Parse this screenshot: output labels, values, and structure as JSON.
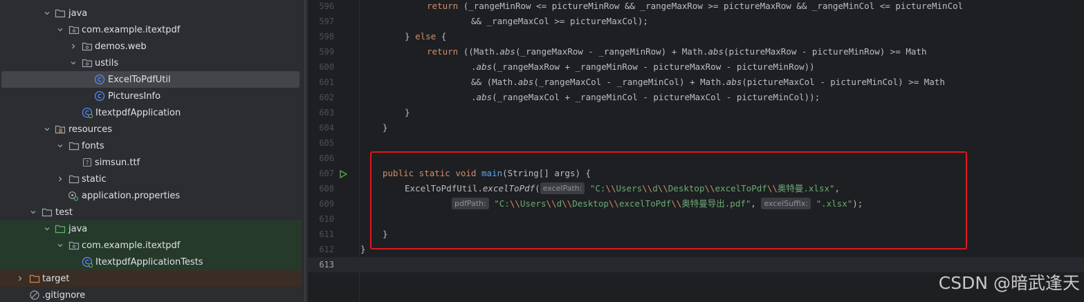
{
  "project_tree": {
    "items": [
      {
        "label": "java",
        "icon": "folder-icon"
      },
      {
        "label": "com.example.itextpdf",
        "icon": "package-icon"
      },
      {
        "label": "demos.web",
        "icon": "package-icon"
      },
      {
        "label": "ustils",
        "icon": "package-icon"
      },
      {
        "label": "ExcelToPdfUtil",
        "icon": "java-class-icon"
      },
      {
        "label": "PicturesInfo",
        "icon": "java-class-icon"
      },
      {
        "label": "ItextpdfApplication",
        "icon": "spring-boot-class-icon"
      },
      {
        "label": "resources",
        "icon": "resources-folder-icon"
      },
      {
        "label": "fonts",
        "icon": "folder-icon"
      },
      {
        "label": "simsun.ttf",
        "icon": "unknown-file-icon"
      },
      {
        "label": "static",
        "icon": "folder-icon"
      },
      {
        "label": "application.properties",
        "icon": "properties-file-icon"
      },
      {
        "label": "test",
        "icon": "folder-icon"
      },
      {
        "label": "java",
        "icon": "test-source-folder-icon"
      },
      {
        "label": "com.example.itextpdf",
        "icon": "package-icon"
      },
      {
        "label": "ItextpdfApplicationTests",
        "icon": "spring-boot-class-icon"
      },
      {
        "label": "target",
        "icon": "excluded-folder-icon"
      },
      {
        "label": ".gitignore",
        "icon": "ignore-file-icon"
      }
    ]
  },
  "editor": {
    "lines": [
      {
        "number": "596",
        "segments": [
          [
            "kw",
            "return "
          ],
          [
            "",
            "(_rangeMinRow <= pictureMinRow && _rangeMaxRow >= pictureMaxRow && _rangeMinCol <= pictureMinCol"
          ]
        ]
      },
      {
        "number": "597",
        "segments": [
          [
            "",
            "&& _rangeMaxCol >= pictureMaxCol);"
          ]
        ]
      },
      {
        "number": "598",
        "segments": [
          [
            "",
            "} "
          ],
          [
            "kw",
            "else "
          ],
          [
            "",
            "{"
          ]
        ]
      },
      {
        "number": "599",
        "segments": [
          [
            "kw",
            "return "
          ],
          [
            "",
            "((Math."
          ],
          [
            "it",
            "abs"
          ],
          [
            "",
            "(_rangeMaxRow - _rangeMinRow) + Math."
          ],
          [
            "it",
            "abs"
          ],
          [
            "",
            "(pictureMaxRow - pictureMinRow) >= Math"
          ]
        ]
      },
      {
        "number": "600",
        "segments": [
          [
            "",
            "."
          ],
          [
            "it",
            "abs"
          ],
          [
            "",
            "(_rangeMaxRow + _rangeMinRow - pictureMaxRow - pictureMinRow))"
          ]
        ]
      },
      {
        "number": "601",
        "segments": [
          [
            "",
            "&& (Math."
          ],
          [
            "it",
            "abs"
          ],
          [
            "",
            "(_rangeMaxCol - _rangeMinCol) + Math."
          ],
          [
            "it",
            "abs"
          ],
          [
            "",
            "(pictureMaxCol - pictureMinCol) >= Math"
          ]
        ]
      },
      {
        "number": "602",
        "segments": [
          [
            "",
            "."
          ],
          [
            "it",
            "abs"
          ],
          [
            "",
            "(_rangeMaxCol + _rangeMinCol - pictureMaxCol - pictureMinCol));"
          ]
        ]
      },
      {
        "number": "603",
        "segments": [
          [
            "",
            "}"
          ]
        ]
      },
      {
        "number": "604",
        "segments": [
          [
            "",
            "}"
          ]
        ]
      },
      {
        "number": "605",
        "segments": []
      },
      {
        "number": "606",
        "segments": []
      },
      {
        "number": "607",
        "segments": [
          [
            "kw",
            "public static void "
          ],
          [
            "fn",
            "main"
          ],
          [
            "",
            "(String[] args) {"
          ]
        ]
      },
      {
        "number": "608",
        "segments": [
          [
            "",
            "ExcelToPdfUtil."
          ],
          [
            "it",
            "excelToPdf"
          ],
          [
            "",
            "("
          ],
          [
            "hint",
            "excelPath:"
          ],
          [
            "str",
            "\"C:"
          ],
          [
            "esc",
            "\\\\"
          ],
          [
            "str",
            "Users"
          ],
          [
            "esc",
            "\\\\"
          ],
          [
            "str",
            "d"
          ],
          [
            "esc",
            "\\\\"
          ],
          [
            "str",
            "Desktop"
          ],
          [
            "esc",
            "\\\\"
          ],
          [
            "str",
            "excelToPdf"
          ],
          [
            "esc",
            "\\\\"
          ],
          [
            "str",
            "奥特曼.xlsx\""
          ],
          [
            "",
            ","
          ]
        ]
      },
      {
        "number": "609",
        "segments": [
          [
            "hint",
            "pdfPath:"
          ],
          [
            "str",
            "\"C:"
          ],
          [
            "esc",
            "\\\\"
          ],
          [
            "str",
            "Users"
          ],
          [
            "esc",
            "\\\\"
          ],
          [
            "str",
            "d"
          ],
          [
            "esc",
            "\\\\"
          ],
          [
            "str",
            "Desktop"
          ],
          [
            "esc",
            "\\\\"
          ],
          [
            "str",
            "excelToPdf"
          ],
          [
            "esc",
            "\\\\"
          ],
          [
            "str",
            "奥特曼导出.pdf\""
          ],
          [
            "",
            ", "
          ],
          [
            "hint",
            "excelSuffix:"
          ],
          [
            "str",
            "\".xlsx\""
          ],
          [
            "",
            ");"
          ]
        ]
      },
      {
        "number": "610",
        "segments": []
      },
      {
        "number": "611",
        "segments": [
          [
            "",
            "}"
          ]
        ]
      },
      {
        "number": "612",
        "segments": [
          [
            "",
            "}"
          ]
        ]
      },
      {
        "number": "613",
        "segments": []
      }
    ]
  },
  "colors": {
    "keyword": "#cf8e6d",
    "method": "#56a8f5",
    "string": "#6aab73",
    "highlight_box": "#e0161d",
    "run_gutter": "#57a64a"
  },
  "watermark": "CSDN @暗武逢天"
}
